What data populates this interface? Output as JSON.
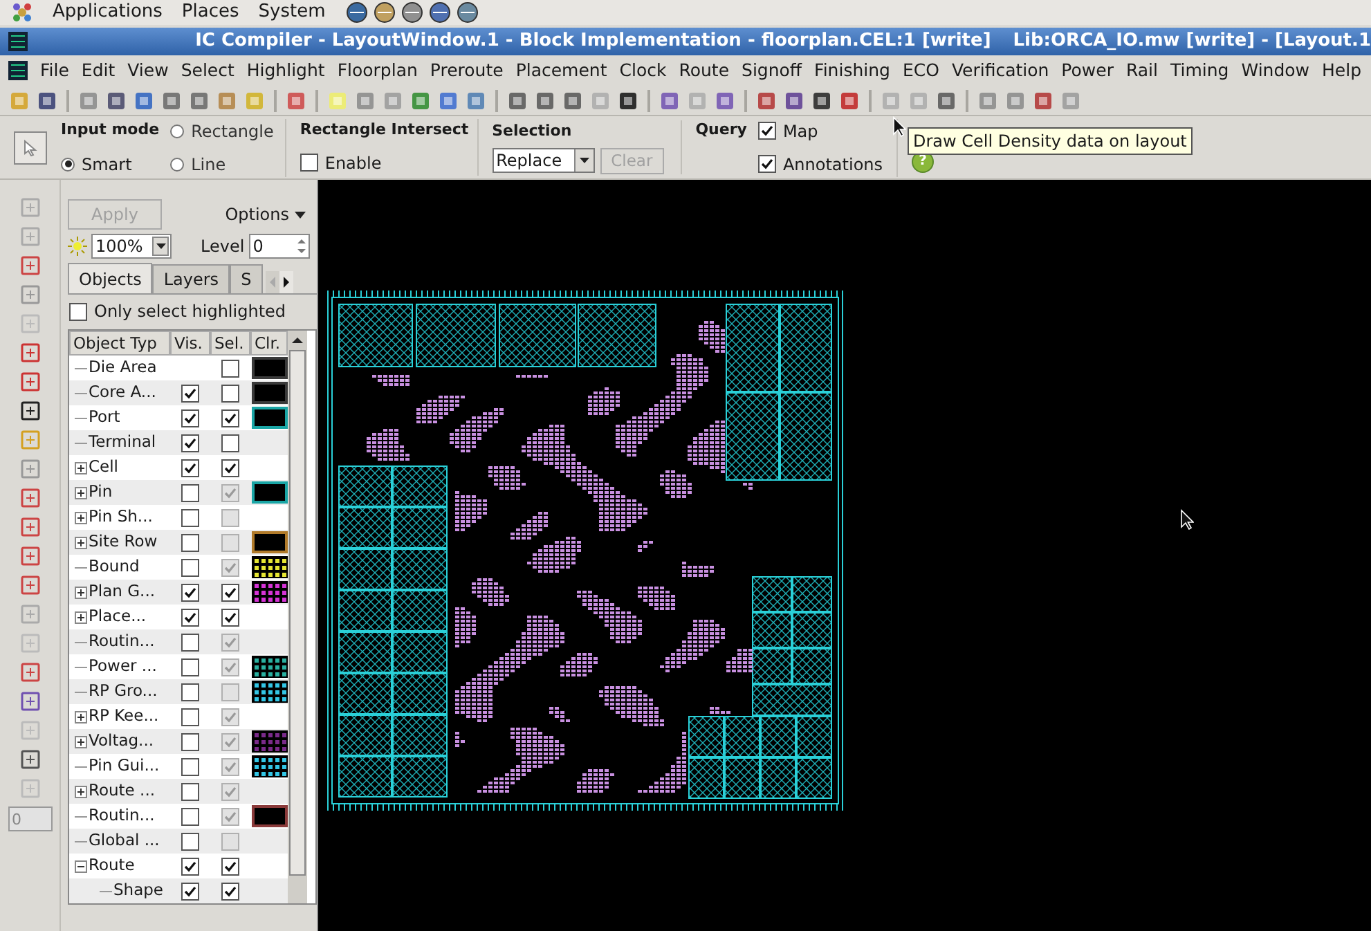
{
  "system_bar": {
    "menus": [
      "Applications",
      "Places",
      "System"
    ]
  },
  "window": {
    "title": "IC Compiler - LayoutWindow.1 - Block Implementation - floorplan.CEL:1 [write]",
    "title_right": "Lib:ORCA_IO.mw [write] - [Layout.1"
  },
  "menu": [
    "File",
    "Edit",
    "View",
    "Select",
    "Highlight",
    "Floorplan",
    "Preroute",
    "Placement",
    "Clock",
    "Route",
    "Signoff",
    "Finishing",
    "ECO",
    "Verification",
    "Power",
    "Rail",
    "Timing",
    "Window",
    "Help"
  ],
  "options_bar": {
    "input_mode_label": "Input mode",
    "input_modes": [
      {
        "label": "Rectangle",
        "selected": false
      },
      {
        "label": "Smart",
        "selected": true
      },
      {
        "label": "Line",
        "selected": false
      }
    ],
    "intersect_label": "Rectangle Intersect",
    "enable": {
      "label": "Enable",
      "checked": false
    },
    "selection_label": "Selection",
    "selection_value": "Replace",
    "clear_button": {
      "label": "Clear",
      "disabled": true
    },
    "query_label": "Query",
    "query_options": [
      {
        "label": "Map",
        "checked": true
      },
      {
        "label": "Annotations",
        "checked": true
      }
    ]
  },
  "help_button": "?",
  "tooltip": "Draw Cell Density data on layout",
  "side_strip": {
    "field_value": "0"
  },
  "panel": {
    "apply_button": {
      "label": "Apply",
      "disabled": true
    },
    "options_label": "Options",
    "brightness_value": "100%",
    "level_label": "Level",
    "level_value": "0",
    "tabs": [
      {
        "label": "Objects",
        "selected": true
      },
      {
        "label": "Layers",
        "selected": false
      },
      {
        "label": "S",
        "selected": false
      }
    ],
    "only_select_highlighted": {
      "label": "Only select highlighted",
      "checked": false
    },
    "table": {
      "columns": [
        "Object Typ",
        "Vis.",
        "Sel.",
        "Clr."
      ],
      "rows": [
        {
          "name": "Die Area",
          "expandable": false,
          "sel": {
            "checked": false,
            "disabled": false
          },
          "swatch": {
            "kind": "solid",
            "color": "#3a3a3a"
          }
        },
        {
          "name": "Core A...",
          "expandable": false,
          "vis": true,
          "sel": {
            "checked": false,
            "disabled": false
          },
          "swatch": {
            "kind": "solid",
            "color": "#3a3a3a"
          }
        },
        {
          "name": "Port",
          "expandable": false,
          "vis": true,
          "sel": {
            "checked": true,
            "disabled": false
          },
          "swatch": {
            "kind": "solid",
            "color": "#1aa6a6"
          }
        },
        {
          "name": "Terminal",
          "expandable": false,
          "vis": true,
          "sel": {
            "checked": false,
            "disabled": false
          }
        },
        {
          "name": "Cell",
          "expandable": true,
          "vis": true,
          "sel": {
            "checked": true,
            "disabled": false
          }
        },
        {
          "name": "Pin",
          "expandable": true,
          "vis": false,
          "sel": {
            "checked": true,
            "disabled": true
          },
          "swatch": {
            "kind": "solid",
            "color": "#1aa6a6"
          }
        },
        {
          "name": "Pin Sh...",
          "expandable": true,
          "vis": false,
          "sel": {
            "checked": false,
            "disabled": true
          }
        },
        {
          "name": "Site Row",
          "expandable": true,
          "vis": false,
          "sel": {
            "checked": false,
            "disabled": true
          },
          "swatch": {
            "kind": "solid",
            "color": "#b07a2a"
          }
        },
        {
          "name": "Bound",
          "expandable": false,
          "vis": false,
          "sel": {
            "checked": true,
            "disabled": true
          },
          "swatch": {
            "kind": "dots",
            "color": "#e6e633"
          }
        },
        {
          "name": "Plan G...",
          "expandable": true,
          "vis": true,
          "sel": {
            "checked": true,
            "disabled": false
          },
          "swatch": {
            "kind": "dots",
            "color": "#d633d6"
          }
        },
        {
          "name": "Place...",
          "expandable": true,
          "vis": true,
          "sel": {
            "checked": true,
            "disabled": false
          }
        },
        {
          "name": "Routin...",
          "expandable": false,
          "vis": false,
          "sel": {
            "checked": true,
            "disabled": true
          }
        },
        {
          "name": "Power ...",
          "expandable": false,
          "vis": false,
          "sel": {
            "checked": true,
            "disabled": true
          },
          "swatch": {
            "kind": "dots",
            "color": "#2ab0a0"
          }
        },
        {
          "name": "RP Gro...",
          "expandable": false,
          "vis": false,
          "sel": {
            "checked": false,
            "disabled": true
          },
          "swatch": {
            "kind": "dots",
            "color": "#33c6e6"
          }
        },
        {
          "name": "RP Kee...",
          "expandable": true,
          "vis": false,
          "sel": {
            "checked": true,
            "disabled": true
          }
        },
        {
          "name": "Voltag...",
          "expandable": true,
          "vis": false,
          "sel": {
            "checked": true,
            "disabled": true
          },
          "swatch": {
            "kind": "dots",
            "color": "#7a2a8a"
          }
        },
        {
          "name": "Pin Gui...",
          "expandable": false,
          "vis": false,
          "sel": {
            "checked": true,
            "disabled": true
          },
          "swatch": {
            "kind": "dots",
            "color": "#33c6e6"
          }
        },
        {
          "name": "Route ...",
          "expandable": true,
          "vis": false,
          "sel": {
            "checked": true,
            "disabled": true
          }
        },
        {
          "name": "Routin...",
          "expandable": false,
          "vis": false,
          "sel": {
            "checked": true,
            "disabled": true
          },
          "swatch": {
            "kind": "solid",
            "color": "#8a3a3a"
          }
        },
        {
          "name": "Global ...",
          "expandable": false,
          "vis": false,
          "sel": {
            "checked": false,
            "disabled": true
          }
        },
        {
          "name": "Route",
          "expandable": true,
          "expanded": true,
          "vis": true,
          "sel": {
            "checked": true,
            "disabled": false
          },
          "children": [
            {
              "name": "Shape",
              "expandable": false,
              "vis": true,
              "sel": {
                "checked": true,
                "disabled": false
              }
            }
          ]
        }
      ]
    }
  }
}
